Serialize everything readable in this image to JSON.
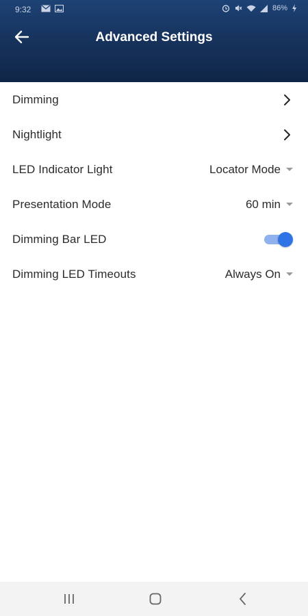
{
  "status_bar": {
    "time": "9:32",
    "battery": "86%",
    "icons": [
      "mail-icon",
      "image-icon",
      "alarm-icon",
      "mute-icon",
      "wifi-icon",
      "signal-icon",
      "battery-charging-icon"
    ]
  },
  "header": {
    "title": "Advanced Settings",
    "back_icon": "arrow-left-icon",
    "gradient_top": "#1d4275",
    "gradient_bottom": "#0f2547"
  },
  "settings": [
    {
      "label": "Dimming",
      "type": "link"
    },
    {
      "label": "Nightlight",
      "type": "link"
    },
    {
      "label": "LED Indicator Light",
      "type": "dropdown",
      "value": "Locator Mode"
    },
    {
      "label": "Presentation Mode",
      "type": "dropdown",
      "value": "60 min"
    },
    {
      "label": "Dimming Bar LED",
      "type": "toggle",
      "on": true
    },
    {
      "label": "Dimming LED Timeouts",
      "type": "dropdown",
      "value": "Always On"
    }
  ],
  "accent_color": "#2f74e6",
  "nav_bar": {
    "icons": [
      "recent-apps-icon",
      "home-icon",
      "back-icon"
    ]
  }
}
